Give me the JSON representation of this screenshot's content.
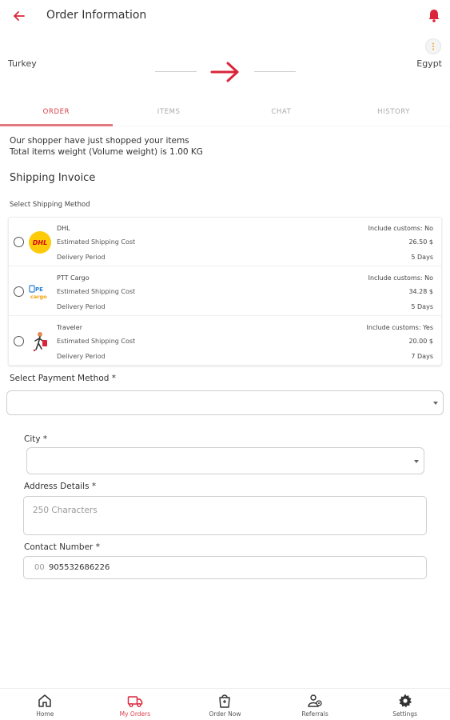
{
  "header": {
    "title": "Order Information"
  },
  "route": {
    "from": "Turkey",
    "to": "Egypt"
  },
  "tabs": [
    {
      "label": "ORDER",
      "active": true
    },
    {
      "label": "ITEMS",
      "active": false
    },
    {
      "label": "CHAT",
      "active": false
    },
    {
      "label": "HISTORY",
      "active": false
    }
  ],
  "status": {
    "line1": "Our shopper have just shopped your items",
    "line2": "Total items weight (Volume weight) is 1.00 KG"
  },
  "shipping": {
    "section_title": "Shipping Invoice",
    "select_label": "Select Shipping Method",
    "cost_label": "Estimated Shipping Cost",
    "period_label": "Delivery Period",
    "methods": [
      {
        "name": "DHL",
        "customs": "Include customs: No",
        "cost": "26.50 $",
        "period": "5 Days",
        "logo": "dhl-logo"
      },
      {
        "name": "PTT Cargo",
        "customs": "Include customs: No",
        "cost": "34.28 $",
        "period": "5 Days",
        "logo": "ptt-cargo-logo"
      },
      {
        "name": "Traveler",
        "customs": "Include customs: Yes",
        "cost": "20.00 $",
        "period": "7 Days",
        "logo": "traveler-logo"
      }
    ]
  },
  "payment": {
    "label": "Select Payment Method *",
    "value": ""
  },
  "city": {
    "label": "City *",
    "value": ""
  },
  "address": {
    "label": "Address Details *",
    "placeholder": "250 Characters"
  },
  "contact": {
    "label": "Contact Number *",
    "prefix": "00",
    "value": "905532686226"
  },
  "bottom_nav": [
    {
      "label": "Home",
      "icon": "home-icon",
      "active": false
    },
    {
      "label": "My Orders",
      "icon": "truck-icon",
      "active": true
    },
    {
      "label": "Order Now",
      "icon": "shopping-bag-icon",
      "active": false
    },
    {
      "label": "Referrals",
      "icon": "referrals-icon",
      "active": false
    },
    {
      "label": "Settings",
      "icon": "gear-icon",
      "active": false
    }
  ],
  "colors": {
    "accent": "#d9263a",
    "tab_active": "#d9404a",
    "tab_underline": "#e07a7f"
  }
}
